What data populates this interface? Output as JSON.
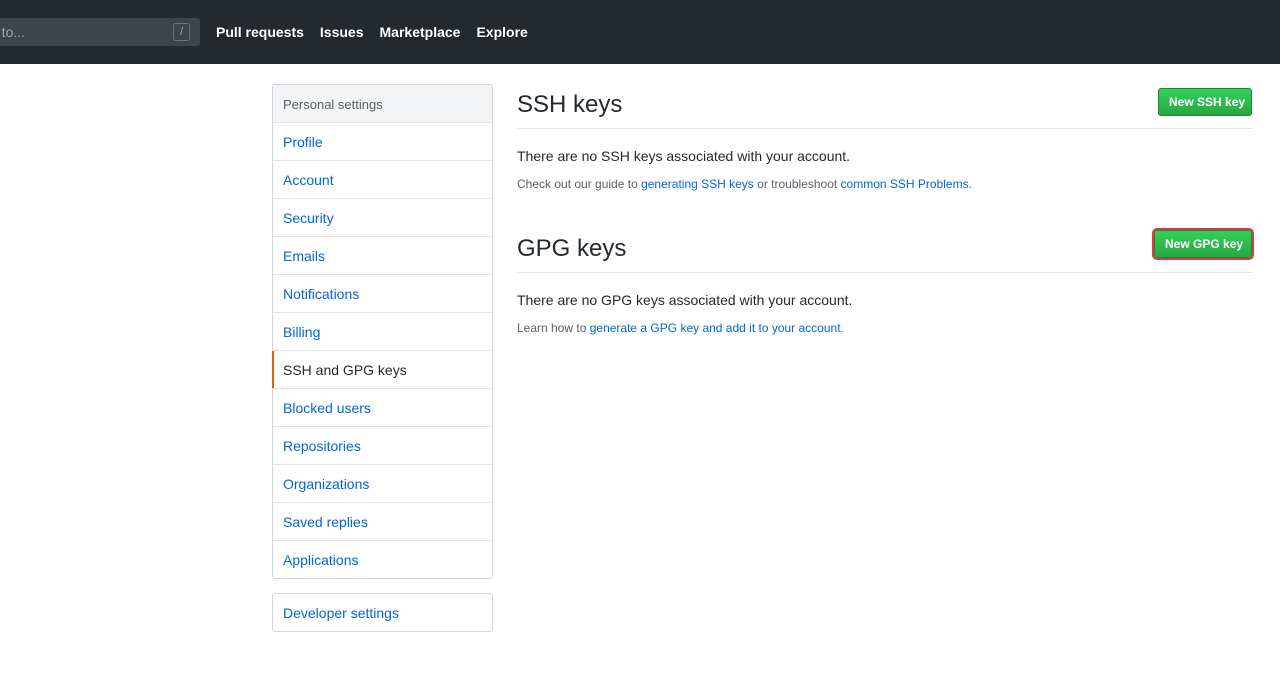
{
  "header": {
    "search_placeholder": "o to...",
    "slash_key": "/",
    "nav": [
      "Pull requests",
      "Issues",
      "Marketplace",
      "Explore"
    ]
  },
  "sidebar": {
    "heading": "Personal settings",
    "items": [
      {
        "label": "Profile"
      },
      {
        "label": "Account"
      },
      {
        "label": "Security"
      },
      {
        "label": "Emails"
      },
      {
        "label": "Notifications"
      },
      {
        "label": "Billing"
      },
      {
        "label": "SSH and GPG keys",
        "selected": true
      },
      {
        "label": "Blocked users"
      },
      {
        "label": "Repositories"
      },
      {
        "label": "Organizations"
      },
      {
        "label": "Saved replies"
      },
      {
        "label": "Applications"
      }
    ],
    "developer": "Developer settings"
  },
  "ssh": {
    "title": "SSH keys",
    "button": "New SSH key",
    "empty": "There are no SSH keys associated with your account.",
    "note_pre": "Check out our guide to ",
    "link1": "generating SSH keys",
    "note_mid": " or troubleshoot ",
    "link2": "common SSH Problems",
    "note_post": "."
  },
  "gpg": {
    "title": "GPG keys",
    "button": "New GPG key",
    "empty": "There are no GPG keys associated with your account.",
    "note_pre": "Learn how to ",
    "link1": "generate a GPG key and add it to your account",
    "note_post": "."
  },
  "colors": {
    "header_bg": "#24292e",
    "link": "#0366d6",
    "button_green": "#28a745",
    "selected_accent": "#e36209",
    "highlight_outline": "#d73a49"
  }
}
